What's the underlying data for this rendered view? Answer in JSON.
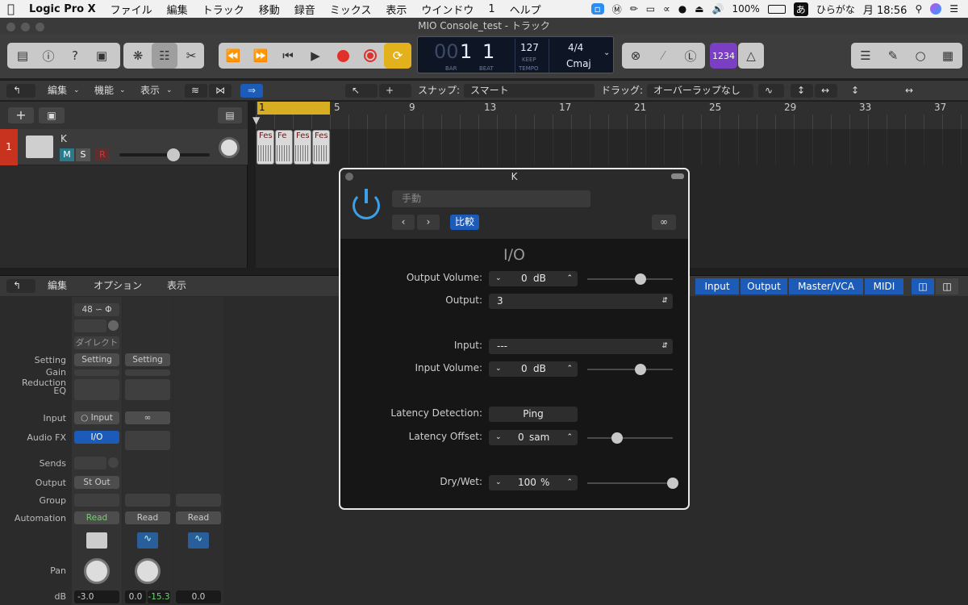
{
  "menubar": {
    "app": "Logic Pro X",
    "items": [
      "ファイル",
      "編集",
      "トラック",
      "移動",
      "録音",
      "ミックス",
      "表示",
      "ウインドウ",
      "1",
      "ヘルプ"
    ],
    "battery": "100%",
    "input_mode": "ひらがな",
    "ime": "あ",
    "clock": "月 18:56"
  },
  "window": {
    "title": "MIO Console_test - トラック"
  },
  "lcd": {
    "bar_dim": "00",
    "bar": "1",
    "beat": "1",
    "bar_label": "BAR",
    "beat_label": "BEAT",
    "tempo": "127",
    "keep": "KEEP",
    "tempo_label": "TEMPO",
    "signature": "4/4",
    "key": "Cmaj"
  },
  "toolbar": {
    "count_in": "1234"
  },
  "secbar": {
    "edit": "編集",
    "function": "機能",
    "view": "表示",
    "snap_label": "スナップ:",
    "snap_value": "スマート",
    "drag_label": "ドラッグ:",
    "drag_value": "オーバーラップなし"
  },
  "ruler": {
    "marks": [
      "1",
      "5",
      "9",
      "13",
      "17",
      "21",
      "25",
      "29",
      "33",
      "37"
    ]
  },
  "track": {
    "number": "1",
    "name": "K",
    "mute": "M",
    "solo": "S",
    "rec": "R",
    "regions": [
      "Fes",
      "Fe",
      "Fes",
      "Fes"
    ]
  },
  "mixbar": {
    "edit": "編集",
    "options": "オプション",
    "view": "表示",
    "tabs": [
      "Input",
      "Output",
      "Master/VCA",
      "MIDI"
    ]
  },
  "mixer": {
    "labels": [
      "Setting",
      "Gain Reduction",
      "EQ",
      "Input",
      "Audio FX",
      "Sends",
      "Output",
      "Group",
      "Automation",
      "Pan",
      "dB"
    ],
    "strip1": {
      "sample_rate": "48",
      "direct": "ダイレクト",
      "setting": "Setting",
      "input": "Input",
      "audio_fx": "I/O",
      "output": "St Out",
      "automation": "Read",
      "db": "-3.0"
    },
    "strip2": {
      "setting": "Setting",
      "automation": "Read",
      "db": "0.0",
      "db_peak": "-15.3"
    },
    "strip3": {
      "automation": "Read",
      "db": "0.0"
    }
  },
  "plugin": {
    "title": "K",
    "preset": "手動",
    "compare": "比較",
    "name": "I/O",
    "output_volume_label": "Output Volume:",
    "output_volume": "0",
    "output_volume_unit": "dB",
    "output_volume_level": 0.62,
    "output_label": "Output:",
    "output_value": "3",
    "input_label": "Input:",
    "input_value": "---",
    "input_volume_label": "Input Volume:",
    "input_volume": "0",
    "input_volume_unit": "dB",
    "input_volume_level": 0.62,
    "latency_detection_label": "Latency Detection:",
    "ping": "Ping",
    "latency_offset_label": "Latency Offset:",
    "latency_offset": "0",
    "latency_offset_unit": "sam",
    "latency_offset_level": 0.35,
    "drywet_label": "Dry/Wet:",
    "drywet": "100",
    "drywet_unit": "%",
    "drywet_level": 1.0
  },
  "colors": {
    "accent_blue": "#1d5bb8",
    "record_red": "#e0302a",
    "cycle_yellow": "#e3b11c",
    "lcd_bg": "#0e1524",
    "track_red": "#c8331f"
  }
}
